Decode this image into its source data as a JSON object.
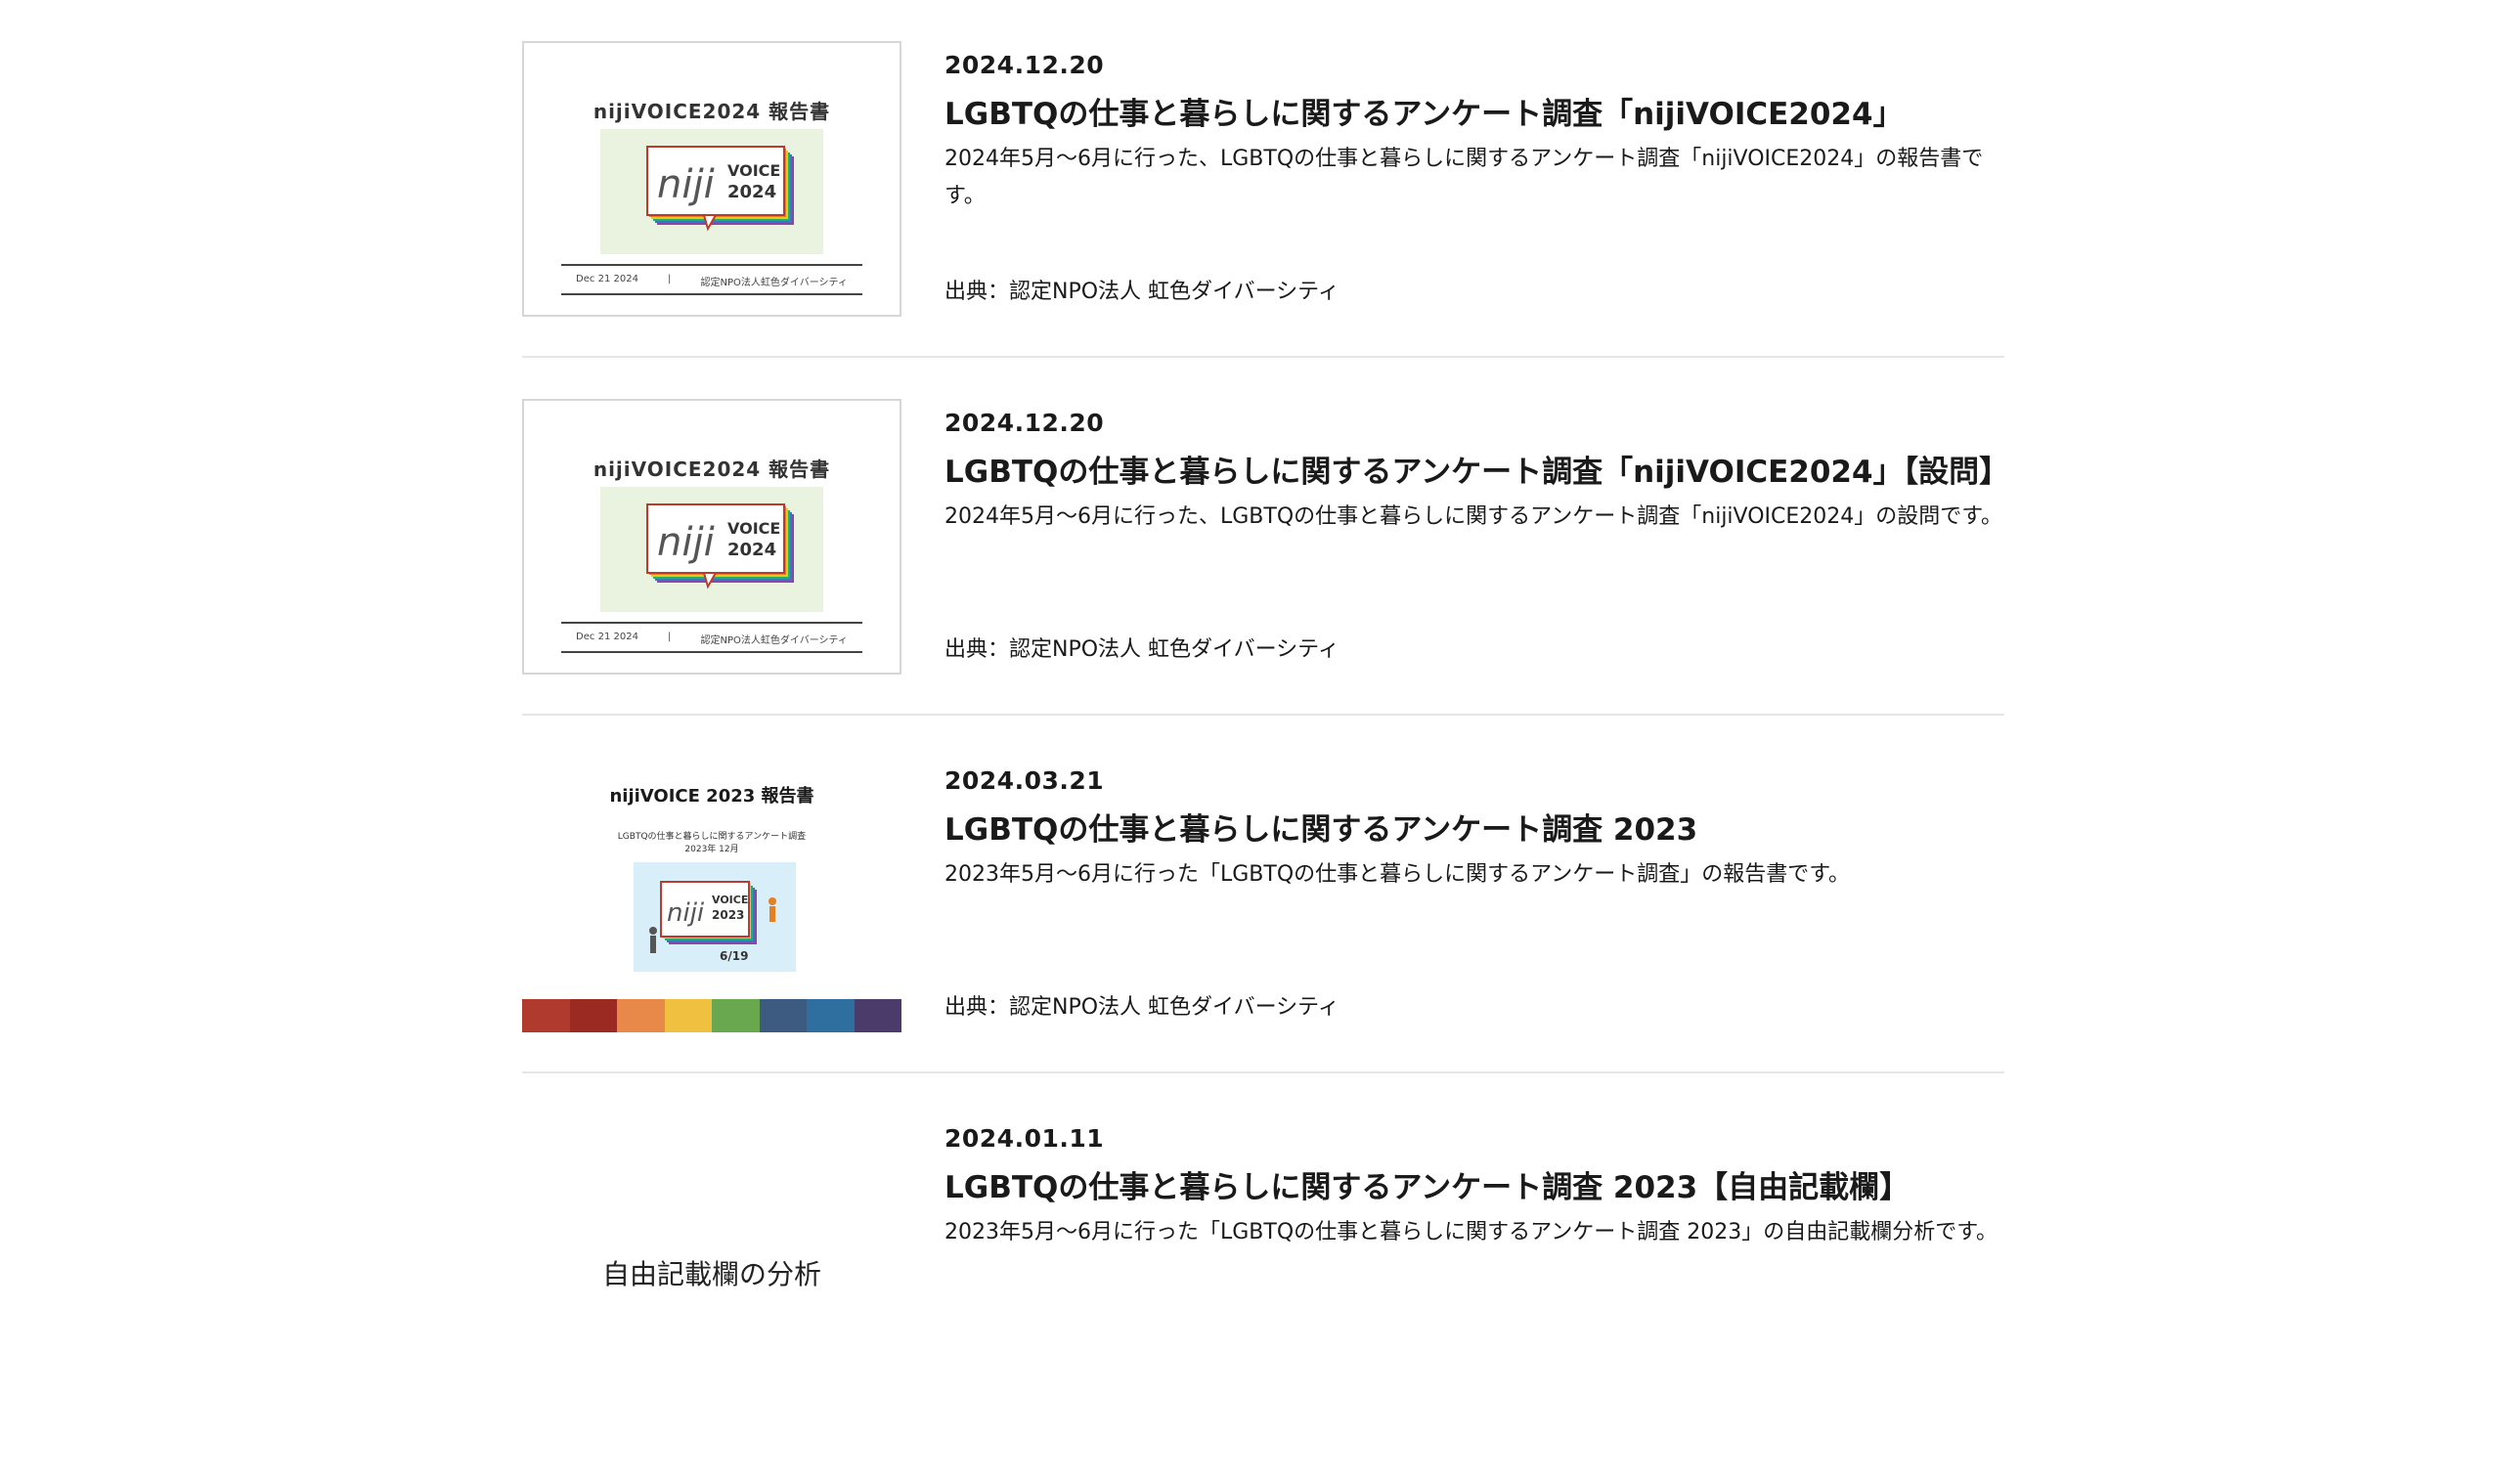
{
  "items": [
    {
      "date": "2024.12.20",
      "title": "LGBTQの仕事と暮らしに関するアンケート調査「nijiVOICE2024」",
      "desc": "2024年5月〜6月に行った、LGBTQの仕事と暮らしに関するアンケート調査「nijiVOICE2024」の報告書です。",
      "source": "出典：認定NPO法人 虹色ダイバーシティ",
      "thumb": {
        "title": "nijiVOICE2024 報告書",
        "logo_a": "niji",
        "logo_b": "VOICE",
        "logo_c": "2024",
        "foot_date": "Dec 21 2024",
        "foot_sep": "|",
        "foot_org": "認定NPO法人虹色ダイバーシティ"
      }
    },
    {
      "date": "2024.12.20",
      "title": "LGBTQの仕事と暮らしに関するアンケート調査「nijiVOICE2024」【設問】",
      "desc": "2024年5月〜6月に行った、LGBTQの仕事と暮らしに関するアンケート調査「nijiVOICE2024」の設問です。",
      "source": "出典：認定NPO法人 虹色ダイバーシティ",
      "thumb": {
        "title": "nijiVOICE2024 報告書",
        "logo_a": "niji",
        "logo_b": "VOICE",
        "logo_c": "2024",
        "foot_date": "Dec 21 2024",
        "foot_sep": "|",
        "foot_org": "認定NPO法人虹色ダイバーシティ"
      }
    },
    {
      "date": "2024.03.21",
      "title": "LGBTQの仕事と暮らしに関するアンケート調査 2023",
      "desc": "2023年5月〜6月に行った「LGBTQの仕事と暮らしに関するアンケート調査」の報告書です。",
      "source": "出典：認定NPO法人 虹色ダイバーシティ",
      "thumb": {
        "title": "nijiVOICE 2023 報告書",
        "sub1": "LGBTQの仕事と暮らしに関するアンケート調査",
        "sub2": "2023年 12月",
        "logo_a": "niji",
        "logo_b": "VOICE",
        "logo_c": "2023",
        "logo_d": "6/19"
      }
    },
    {
      "date": "2024.01.11",
      "title": "LGBTQの仕事と暮らしに関するアンケート調査 2023【自由記載欄】",
      "desc": "2023年5月〜6月に行った「LGBTQの仕事と暮らしに関するアンケート調査 2023」の自由記載欄分析です。",
      "thumb": {
        "label": "自由記載欄の分析"
      }
    }
  ],
  "colors": {
    "rainbow": [
      "#c0392b",
      "#e67e22",
      "#f1c40f",
      "#27ae60",
      "#2980b9",
      "#8e44ad"
    ],
    "stripe": [
      "#b03a2e",
      "#9b2a22",
      "#e8894a",
      "#f0c040",
      "#6aa84f",
      "#3d5a80",
      "#2f6f9f",
      "#4a3b6b"
    ]
  }
}
